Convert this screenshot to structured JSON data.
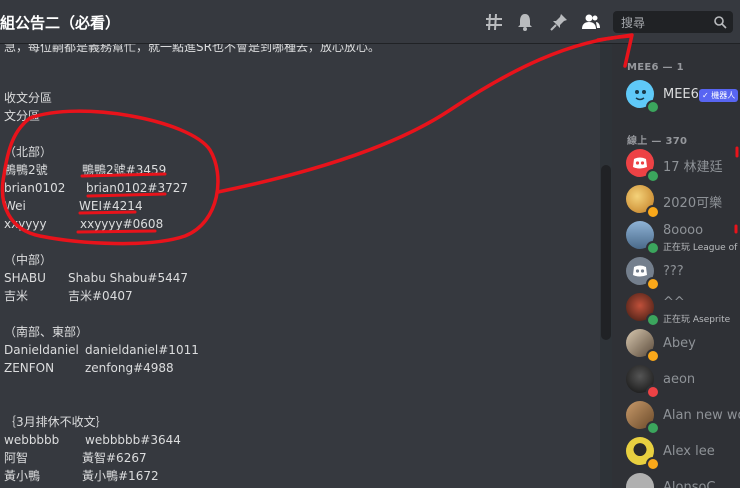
{
  "channel": {
    "title": "組公告二（必看）"
  },
  "toolbar": {
    "icons": [
      "threads-icon",
      "bell-icon",
      "pin-icon",
      "members-icon"
    ],
    "search_placeholder": "搜尋"
  },
  "content": {
    "truncated_line": "急，每位嗣都是義務幫忙，就一點進SR也不會是到哪種去，放心放心。",
    "header_lines": [
      "收文分區",
      "文分區"
    ],
    "sections": [
      {
        "heading": "（北部）",
        "rows": [
          {
            "name": "鴨鴨2號",
            "tag": "鴨鴨2號#3459"
          },
          {
            "name": "brian0102",
            "tag": "brian0102#3727"
          },
          {
            "name": "Wei",
            "tag": "WEI#4214"
          },
          {
            "name": "xxyyyy",
            "tag": "xxyyyy#0608"
          }
        ]
      },
      {
        "heading": "（中部）",
        "rows": [
          {
            "name": "SHABU",
            "tag": "Shabu Shabu#5447"
          },
          {
            "name": "吉米",
            "tag": "吉米#0407"
          }
        ]
      },
      {
        "heading": "（南部、東部）",
        "rows": [
          {
            "name": "Danieldaniel",
            "tag": "danieldaniel#1011"
          },
          {
            "name": "ZENFON",
            "tag": "zenfong#4988"
          }
        ]
      },
      {
        "heading": "｛3月排休不收文｝",
        "rows": [
          {
            "name": "webbbbb",
            "tag": "webbbbb#3644"
          },
          {
            "name": "阿智",
            "tag": "黃智#6267"
          },
          {
            "name": "黃小鴨",
            "tag": "黃小鴨#1672"
          }
        ]
      }
    ]
  },
  "members": {
    "groups": [
      {
        "header": "MEE6 — 1",
        "items": [
          {
            "name": "MEE6",
            "badge": "✓ 機器人",
            "activity": "",
            "status": "online",
            "avatar_color": "#5fc9f8"
          }
        ]
      },
      {
        "header": "線上 — 370",
        "items": [
          {
            "name": "17 林建廷",
            "activity": "",
            "status": "online",
            "avatar_color": "#ed4245"
          },
          {
            "name": "2020可樂",
            "activity": "",
            "status": "idle",
            "avatar_color": "#e8b04a"
          },
          {
            "name": "8oooo",
            "activity": "正在玩 League of",
            "status": "online",
            "avatar_color": "#6b8fb0"
          },
          {
            "name": "???",
            "activity": "",
            "status": "idle",
            "avatar_color": "#747f8d"
          },
          {
            "name": "^^",
            "activity": "正在玩 Aseprite",
            "status": "online",
            "avatar_color": "#7a3f2a"
          },
          {
            "name": "Abey",
            "activity": "",
            "status": "idle",
            "avatar_color": "#8a7a6a"
          },
          {
            "name": "aeon",
            "activity": "",
            "status": "dnd",
            "avatar_color": "#2a2a2a"
          },
          {
            "name": "Alan new wor",
            "activity": "",
            "status": "online",
            "avatar_color": "#9a6e4a"
          },
          {
            "name": "Alex lee",
            "activity": "",
            "status": "idle",
            "avatar_color": "#d9c040"
          },
          {
            "name": "AlonsoC",
            "activity": "",
            "status": "online",
            "avatar_color": "#b0b0b0"
          }
        ]
      }
    ]
  },
  "colors": {
    "background": "#36393f",
    "sidebar": "#2f3136",
    "annotation_red": "#e8131b",
    "online": "#3ba55d",
    "idle": "#faa81a",
    "dnd": "#ed4245",
    "bot_badge": "#5865f2"
  }
}
